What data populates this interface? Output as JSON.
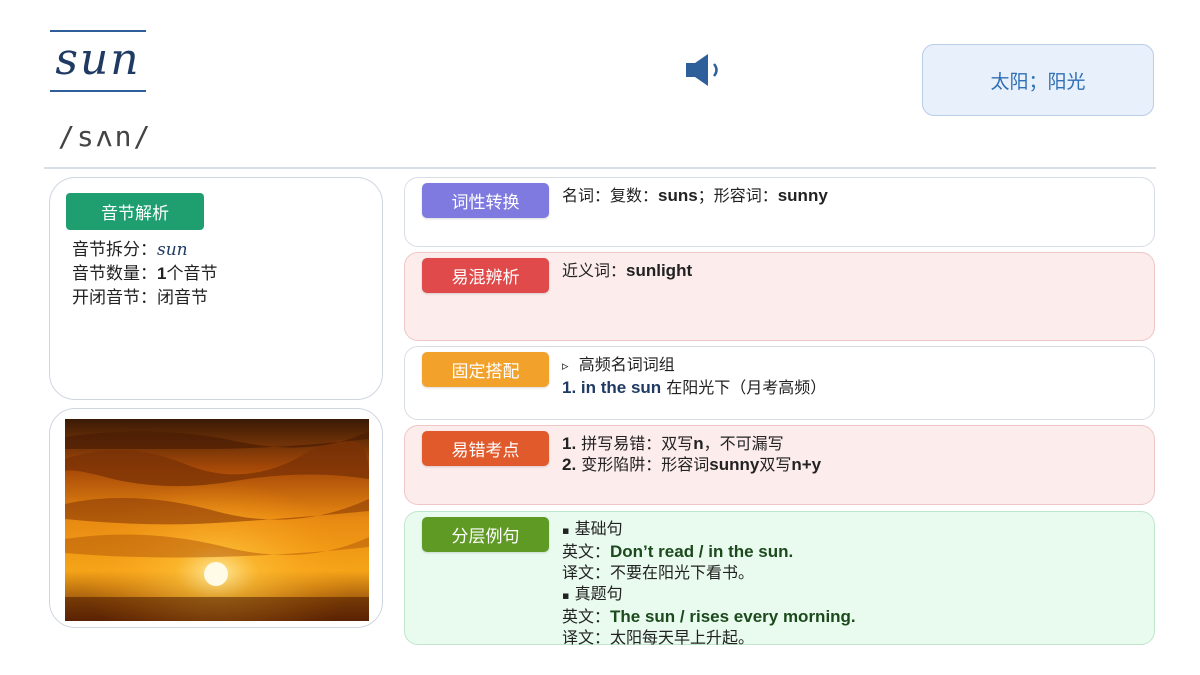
{
  "header": {
    "word": "sun",
    "phonetic": "/sʌn/",
    "meaning": "太阳；阳光"
  },
  "syllable": {
    "tag": "音节解析",
    "split_label": "音节拆分：",
    "split_value": "sun",
    "count_label": "音节数量：",
    "count_num": "1",
    "count_unit": "个音节",
    "type_label": "开闭音节：",
    "type_value": "闭音节"
  },
  "pos": {
    "tag": "词性转换",
    "text1": "名词：复数：",
    "plural": "suns",
    "text2": "；形容词：",
    "adj": "sunny"
  },
  "confuse": {
    "tag": "易混辨析",
    "text": "近义词：",
    "word": "sunlight"
  },
  "collocation": {
    "tag": "固定搭配",
    "marker": "▹",
    "heading": "高频名词词组",
    "num": "1. in the sun",
    "desc": " 在阳光下（月考高频）"
  },
  "mistakes": {
    "tag": "易错考点",
    "n1": "1.",
    "t1a": " 拼写易错：双写",
    "t1b": "n",
    "t1c": "，不可漏写",
    "n2": "2.",
    "t2a": " 变形陷阱：形容词",
    "t2b": "sunny",
    "t2c": "双写",
    "t2d": "n+y"
  },
  "examples": {
    "tag": "分层例句",
    "bullet": "▪",
    "h1": "基础句",
    "en_label": "英文：",
    "en1": "Don’t read / in the sun.",
    "zh_label": "译文：",
    "zh1": "不要在阳光下看书。",
    "h2": "真题句",
    "en2": "The sun / rises every morning.",
    "zh2": "太阳每天早上升起。"
  },
  "colors": {
    "accent": "#2e5f9b",
    "syllable_tag": "#1f9e70",
    "pos_tag": "#7f7ae0",
    "confuse_tag": "#e14a4a",
    "collocation_tag": "#f2a22a",
    "mistakes_tag": "#e05a2c",
    "examples_tag": "#5f9a24"
  },
  "icons": {
    "speaker": "speaker-icon"
  }
}
